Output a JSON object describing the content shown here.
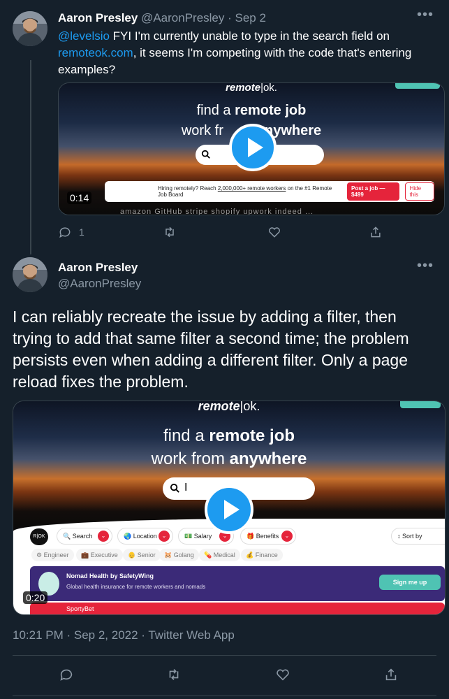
{
  "tweet1": {
    "name": "Aaron Presley",
    "handle": "@AaronPresley",
    "date": "· Sep 2",
    "more": "•••",
    "mention": "@levelsio",
    "text_a": " FYI I'm currently unable to type in the search field on ",
    "link": "remoteok.com",
    "text_b": ", it seems I'm competing with the code that's entering examples?",
    "video": {
      "logo_left": "remote",
      "logo_right": "|ok.",
      "headline_a": "find a ",
      "headline_a_bold": "remote job",
      "headline_b": "work fr",
      "headline_b_bold": "anywhere",
      "hire_text": "Hiring remotely? Reach ",
      "hire_reach": "2,000,000+ remote workers",
      "hire_text2": " on the ",
      "hire_text3": "#1 Remote Job Board",
      "post_job": "Post a job — $499",
      "hide": "Hide this",
      "brands": "amazon   GitHub   stripe   shopify   upwork   indeed   ...",
      "duration": "0:14"
    },
    "reply_count": "1"
  },
  "tweet2": {
    "name": "Aaron Presley",
    "handle": "@AaronPresley",
    "more": "•••",
    "text": "I can reliably recreate the issue by adding a filter, then trying to add that same filter a second time; the problem persists even when adding a different filter. Only a page reload fixes the problem.",
    "video": {
      "logo_left": "remote",
      "logo_right": "|ok.",
      "headline_a": "find a ",
      "headline_a_bold": "remote job",
      "headline_b": "work from ",
      "headline_b_bold": "anywhere",
      "search_cursor": "I",
      "filters": [
        "Search",
        "Location",
        "Salary",
        "Benefits"
      ],
      "sort_by": "Sort by",
      "tags": [
        "Engineer",
        "Executive",
        "Senior",
        "Golang",
        "Medical",
        "Finance"
      ],
      "banner_title": "Nomad Health by SafetyWing",
      "banner_sub": "Global health insurance for remote workers and nomads",
      "sign_me_up": "Sign me up",
      "next_company": "SportyBet",
      "duration": "0:20"
    },
    "timestamp": "10:21 PM · Sep 2, 2022 · Twitter Web App"
  },
  "colors": {
    "background": "#15202b",
    "link": "#1d9bf0",
    "muted": "#8b98a5",
    "divider": "#38444d",
    "accent_red": "#e5243b"
  },
  "icons": [
    "reply-icon",
    "retweet-icon",
    "like-icon",
    "share-icon",
    "play-icon",
    "more-icon"
  ]
}
